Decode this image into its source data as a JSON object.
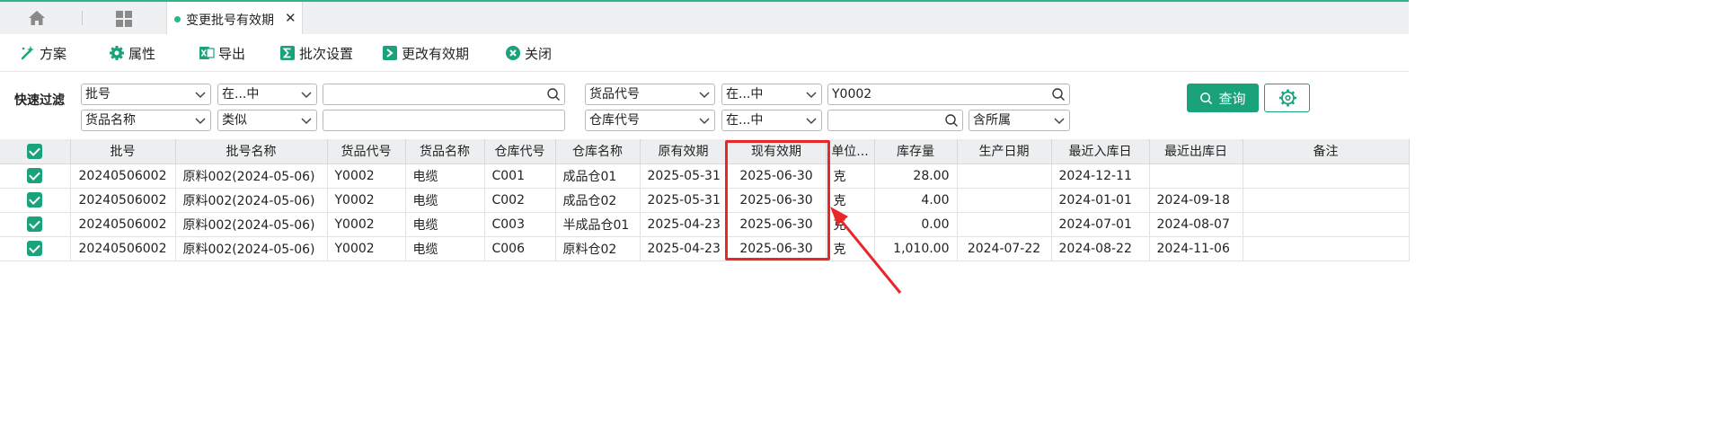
{
  "tabs": {
    "active_label": "变更批号有效期",
    "home_icon": "home-icon",
    "grid_icon": "grid-icon"
  },
  "toolbar": {
    "scheme": "方案",
    "properties": "属性",
    "export": "导出",
    "batch_settings": "批次设置",
    "change_expiry": "更改有效期",
    "close": "关闭"
  },
  "filter": {
    "label": "快速过滤",
    "row1": {
      "field1": "批号",
      "op1": "在...中",
      "value1": "",
      "field2": "货品代号",
      "op2": "在...中",
      "value2": "Y0002"
    },
    "row2": {
      "field1": "货品名称",
      "op1": "类似",
      "value1": "",
      "field2": "仓库代号",
      "op2": "在...中",
      "value2": "",
      "scope": "含所属"
    },
    "query_button": "查询"
  },
  "table": {
    "headers": [
      "批号",
      "批号名称",
      "货品代号",
      "货品名称",
      "仓库代号",
      "仓库名称",
      "原有效期",
      "现有效期",
      "单位...",
      "库存量",
      "生产日期",
      "最近入库日",
      "最近出库日",
      "备注"
    ],
    "rows": [
      [
        "20240506002",
        "原料002(2024-05-06)",
        "Y0002",
        "电缆",
        "C001",
        "成品仓01",
        "2025-05-31",
        "2025-06-30",
        "克",
        "28.00",
        "",
        "2024-12-11",
        "",
        ""
      ],
      [
        "20240506002",
        "原料002(2024-05-06)",
        "Y0002",
        "电缆",
        "C002",
        "成品仓02",
        "2025-05-31",
        "2025-06-30",
        "克",
        "4.00",
        "",
        "2024-01-01",
        "2024-09-18",
        ""
      ],
      [
        "20240506002",
        "原料002(2024-05-06)",
        "Y0002",
        "电缆",
        "C003",
        "半成品仓01",
        "2025-04-23",
        "2025-06-30",
        "克",
        "0.00",
        "",
        "2024-07-01",
        "2024-08-07",
        ""
      ],
      [
        "20240506002",
        "原料002(2024-05-06)",
        "Y0002",
        "电缆",
        "C006",
        "原料仓02",
        "2025-04-23",
        "2025-06-30",
        "克",
        "1,010.00",
        "2024-07-22",
        "2024-08-22",
        "2024-11-06",
        ""
      ]
    ]
  },
  "colors": {
    "accent": "#1aa37a",
    "annotation": "#e8272a"
  }
}
